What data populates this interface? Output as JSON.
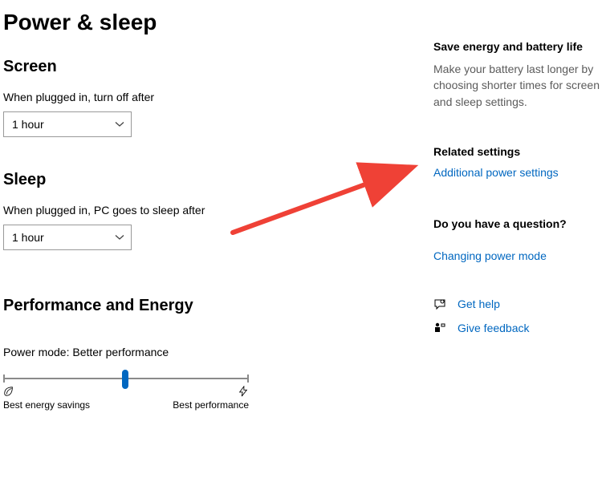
{
  "page_title": "Power & sleep",
  "screen": {
    "heading": "Screen",
    "label": "When plugged in, turn off after",
    "value": "1 hour"
  },
  "sleep": {
    "heading": "Sleep",
    "label": "When plugged in, PC goes to sleep after",
    "value": "1 hour"
  },
  "performance": {
    "heading": "Performance and Energy",
    "mode_label": "Power mode: Better performance",
    "left_end": "Best energy savings",
    "right_end": "Best performance"
  },
  "side": {
    "energy_heading": "Save energy and battery life",
    "energy_desc": "Make your battery last longer by choosing shorter times for screen and sleep settings.",
    "related_heading": "Related settings",
    "additional_link": "Additional power settings",
    "question_heading": "Do you have a question?",
    "changing_link": "Changing power mode",
    "get_help": "Get help",
    "give_feedback": "Give feedback"
  }
}
